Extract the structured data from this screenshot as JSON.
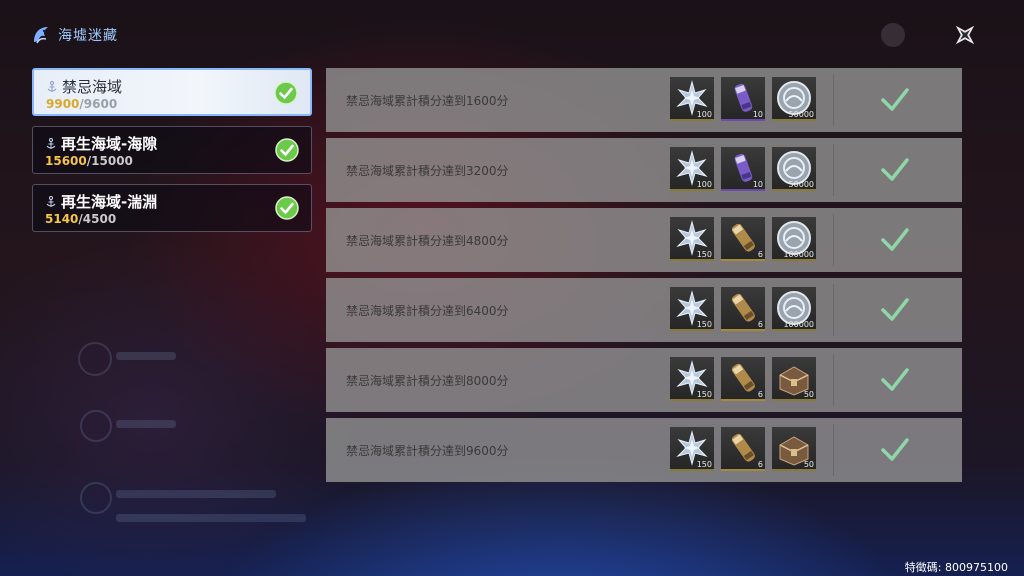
{
  "header": {
    "title": "海墟迷藏"
  },
  "zones": [
    {
      "name": "禁忌海域",
      "current": "9900",
      "goal": "9600",
      "completed": true,
      "active": true
    },
    {
      "name": "再生海域-海隙",
      "current": "15600",
      "goal": "15000",
      "completed": true,
      "active": false
    },
    {
      "name": "再生海域-湍淵",
      "current": "5140",
      "goal": "4500",
      "completed": true,
      "active": false
    }
  ],
  "rewards": [
    {
      "requirement": "禁忌海域累計積分達到1600分",
      "items": [
        {
          "icon": "star-crystal-icon",
          "qty": "100"
        },
        {
          "icon": "purple-scroll-icon",
          "qty": "10"
        },
        {
          "icon": "silver-coin-icon",
          "qty": "50000"
        }
      ],
      "claimed": true
    },
    {
      "requirement": "禁忌海域累計積分達到3200分",
      "items": [
        {
          "icon": "star-crystal-icon",
          "qty": "100"
        },
        {
          "icon": "purple-scroll-icon",
          "qty": "10"
        },
        {
          "icon": "silver-coin-icon",
          "qty": "50000"
        }
      ],
      "claimed": true
    },
    {
      "requirement": "禁忌海域累計積分達到4800分",
      "items": [
        {
          "icon": "star-crystal-icon",
          "qty": "150"
        },
        {
          "icon": "gold-scroll-icon",
          "qty": "6"
        },
        {
          "icon": "silver-coin-icon",
          "qty": "100000"
        }
      ],
      "claimed": true
    },
    {
      "requirement": "禁忌海域累計積分達到6400分",
      "items": [
        {
          "icon": "star-crystal-icon",
          "qty": "150"
        },
        {
          "icon": "gold-scroll-icon",
          "qty": "6"
        },
        {
          "icon": "silver-coin-icon",
          "qty": "100000"
        }
      ],
      "claimed": true
    },
    {
      "requirement": "禁忌海域累計積分達到8000分",
      "items": [
        {
          "icon": "star-crystal-icon",
          "qty": "150"
        },
        {
          "icon": "gold-scroll-icon",
          "qty": "6"
        },
        {
          "icon": "treasure-chest-icon",
          "qty": "50"
        }
      ],
      "claimed": true
    },
    {
      "requirement": "禁忌海域累計積分達到9600分",
      "items": [
        {
          "icon": "star-crystal-icon",
          "qty": "150"
        },
        {
          "icon": "gold-scroll-icon",
          "qty": "6"
        },
        {
          "icon": "treasure-chest-icon",
          "qty": "50"
        }
      ],
      "claimed": true
    }
  ],
  "footer": {
    "feature_code": "特徵碼: 800975100"
  },
  "colors": {
    "score_current": "#f5c544",
    "check_green": "#6cc94a",
    "claimed_check": "#8fd6a8",
    "accent_blue": "#8ab8ff"
  }
}
